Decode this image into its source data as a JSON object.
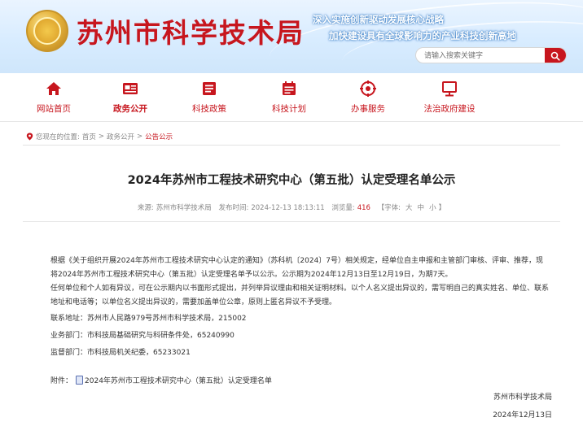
{
  "header": {
    "site_title": "苏州市科学技术局",
    "slogan_line1": "深入实施创新驱动发展核心战略",
    "slogan_line2": "加快建设具有全球影响力的产业科技创新高地",
    "search_placeholder": "请输入搜索关键字"
  },
  "nav": {
    "items": [
      {
        "label": "网站首页",
        "icon": "home-icon"
      },
      {
        "label": "政务公开",
        "icon": "open-government-icon"
      },
      {
        "label": "科技政策",
        "icon": "policy-icon"
      },
      {
        "label": "科技计划",
        "icon": "plan-icon"
      },
      {
        "label": "办事服务",
        "icon": "service-icon"
      },
      {
        "label": "法治政府建设",
        "icon": "law-government-icon"
      }
    ]
  },
  "breadcrumb": {
    "prefix": "您现在的位置:",
    "items": [
      "首页",
      "政务公开",
      "公告公示"
    ],
    "separator": ">"
  },
  "article": {
    "title": "2024年苏州市工程技术研究中心（第五批）认定受理名单公示",
    "source_label": "来源:",
    "source": "苏州市科学技术局",
    "date_label": "发布时间:",
    "date": "2024-12-13 18:13:11",
    "views_label": "浏览量:",
    "views": "416",
    "font_label": "【字体:",
    "font_large": "大",
    "font_medium": "中",
    "font_small": "小",
    "font_end": "】",
    "paragraph1": "根据《关于组织开展2024年苏州市工程技术研究中心认定的通知》（苏科机〔2024〕7号）相关规定，经单位自主申报和主管部门审核、评审、推荐，现将2024年苏州市工程技术研究中心（第五批）认定受理名单予以公示。公示期为2024年12月13日至12月19日，为期7天。",
    "paragraph2": "任何单位和个人如有异议，可在公示期内以书面形式提出，并列举异议理由和相关证明材料。以个人名义提出异议的，需写明自己的真实姓名、单位、联系地址和电话等；以单位名义提出异议的，需要加盖单位公章，原则上匿名异议不予受理。",
    "address": "联系地址：苏州市人民路979号苏州市科学技术局，215002",
    "business_dept": "业务部门：市科技局基础研究与科研条件处，65240990",
    "supervision_dept": "监督部门：市科技局机关纪委，65233021",
    "attachment_label": "附件：",
    "attachment_name": "2024年苏州市工程技术研究中心（第五批）认定受理名单",
    "signature_org": "苏州市科学技术局",
    "signature_date": "2024年12月13日"
  },
  "colors": {
    "brand_red": "#c7161e",
    "banner_blue": "#d8ecff"
  }
}
